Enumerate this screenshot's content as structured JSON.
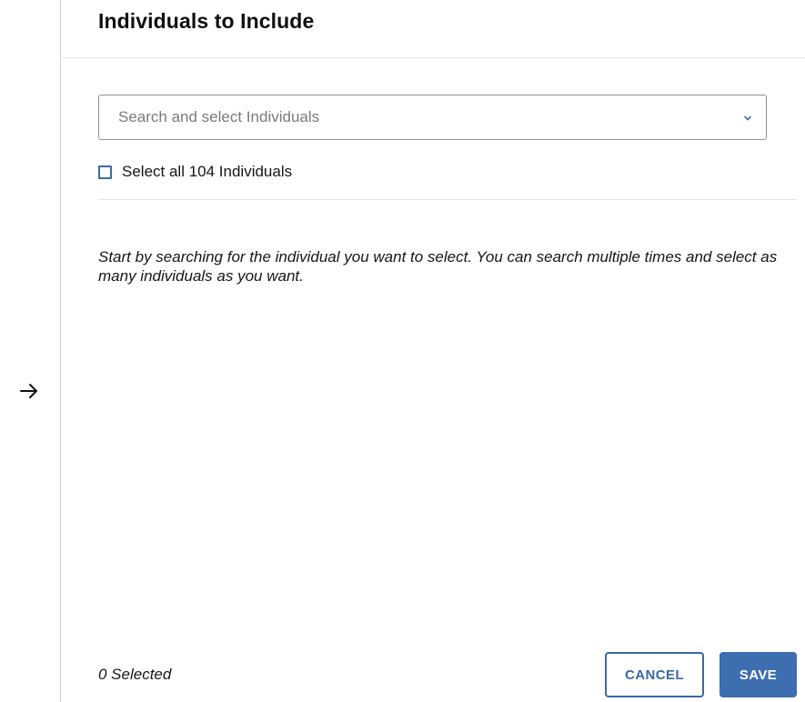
{
  "panel": {
    "title": "Individuals to Include"
  },
  "search": {
    "placeholder": "Search and select Individuals",
    "value": ""
  },
  "select_all": {
    "label": "Select all 104 Individuals",
    "checked": false
  },
  "hint": {
    "text": "Start by searching for the individual you want to select. You can search multiple times and select as many individuals as you want."
  },
  "footer": {
    "selected_count": "0 Selected",
    "cancel_label": "CANCEL",
    "save_label": "SAVE"
  },
  "icons": {
    "collapse": "arrow-right-icon",
    "dropdown": "chevron-down-icon"
  },
  "colors": {
    "accent": "#3d6eb0",
    "cancel_border": "#3a68a5",
    "checkbox_border": "#3d6aa6"
  }
}
